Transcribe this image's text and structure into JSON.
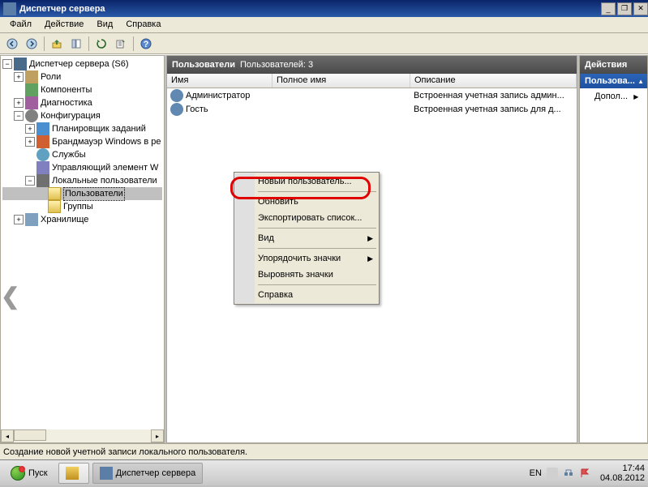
{
  "window": {
    "title": "Диспетчер сервера"
  },
  "menu": {
    "file": "Файл",
    "action": "Действие",
    "view": "Вид",
    "help": "Справка"
  },
  "tree": {
    "root": "Диспетчер сервера (S6)",
    "roles": "Роли",
    "components": "Компоненты",
    "diag": "Диагностика",
    "config": "Конфигурация",
    "scheduler": "Планировщик заданий",
    "firewall": "Брандмауэр Windows в ре",
    "services": "Службы",
    "wmi": "Управляющий элемент W",
    "localusers": "Локальные пользователи",
    "users": "Пользователи",
    "groups": "Группы",
    "storage": "Хранилище"
  },
  "content": {
    "header": "Пользователи",
    "count_label": "Пользователей: 3",
    "columns": {
      "name": "Имя",
      "fullname": "Полное имя",
      "desc": "Описание"
    },
    "rows": [
      {
        "name": "Администратор",
        "fullname": "",
        "desc": "Встроенная учетная запись админ..."
      },
      {
        "name": "Гость",
        "fullname": "",
        "desc": "Встроенная учетная запись для д..."
      }
    ]
  },
  "ctx": {
    "new_user": "Новый пользователь...",
    "refresh": "Обновить",
    "export": "Экспортировать список...",
    "view": "Вид",
    "arrange": "Упорядочить значки",
    "align": "Выровнять значки",
    "help": "Справка"
  },
  "actions": {
    "header": "Действия",
    "section": "Пользова...",
    "more": "Допол..."
  },
  "statusbar": "Создание новой учетной записи локального пользователя.",
  "taskbar": {
    "start": "Пуск",
    "app": "Диспетчер сервера",
    "lang": "EN",
    "time": "17:44",
    "date": "04.08.2012"
  }
}
